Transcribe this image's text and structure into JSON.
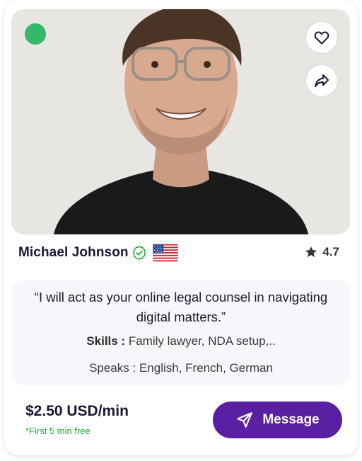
{
  "profile": {
    "name": "Michael Johnson",
    "rating": "4.7",
    "quote": "“I will act as your online legal counsel in navigating digital matters.”",
    "skills_label": "Skills :",
    "skills_value": "Family lawyer, NDA setup,..",
    "speaks_label": "Speaks :",
    "speaks_value": "English, French, German",
    "status": "online",
    "country_flag": "us-flag-icon"
  },
  "pricing": {
    "price": "$2.50 USD/min",
    "free_note": "*First 5 min free"
  },
  "actions": {
    "message_label": "Message",
    "favorite_icon": "heart-icon",
    "share_icon": "share-icon"
  },
  "colors": {
    "online": "#34b86a",
    "verified": "#1bae38",
    "primary_button": "#5a1fa3",
    "free_note": "#1bae38"
  }
}
